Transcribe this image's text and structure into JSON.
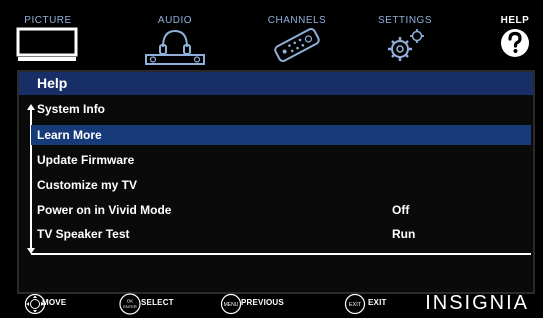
{
  "tabs": [
    {
      "label": "PICTURE",
      "icon": "tv-icon"
    },
    {
      "label": "AUDIO",
      "icon": "headphones-icon"
    },
    {
      "label": "CHANNELS",
      "icon": "remote-icon"
    },
    {
      "label": "SETTINGS",
      "icon": "gears-icon"
    },
    {
      "label": "HELP",
      "icon": "question-icon",
      "active": true
    }
  ],
  "panel": {
    "title": "Help",
    "items": [
      {
        "label": "System Info",
        "value": ""
      },
      {
        "label": "Learn More",
        "value": "",
        "highlighted": true
      },
      {
        "label": "Update Firmware",
        "value": ""
      },
      {
        "label": "Customize my TV",
        "value": ""
      },
      {
        "label": "Power on in Vivid Mode",
        "value": "Off"
      },
      {
        "label": "TV Speaker Test",
        "value": "Run"
      }
    ]
  },
  "footer": {
    "hints": [
      {
        "icon": "dpad-icon",
        "label": "MOVE"
      },
      {
        "icon": "ok-enter-icon",
        "label": "SELECT",
        "icon_text": "OK ENTER"
      },
      {
        "icon": "menu-icon",
        "label": "PREVIOUS",
        "icon_text": "MENU"
      },
      {
        "icon": "exit-icon",
        "label": "EXIT",
        "icon_text": "EXIT"
      }
    ],
    "brand": "INSIGNIA"
  },
  "colors": {
    "header_bg": "#172e66",
    "highlight_bg": "#173a78",
    "tab_label": "#8fb0d8"
  }
}
